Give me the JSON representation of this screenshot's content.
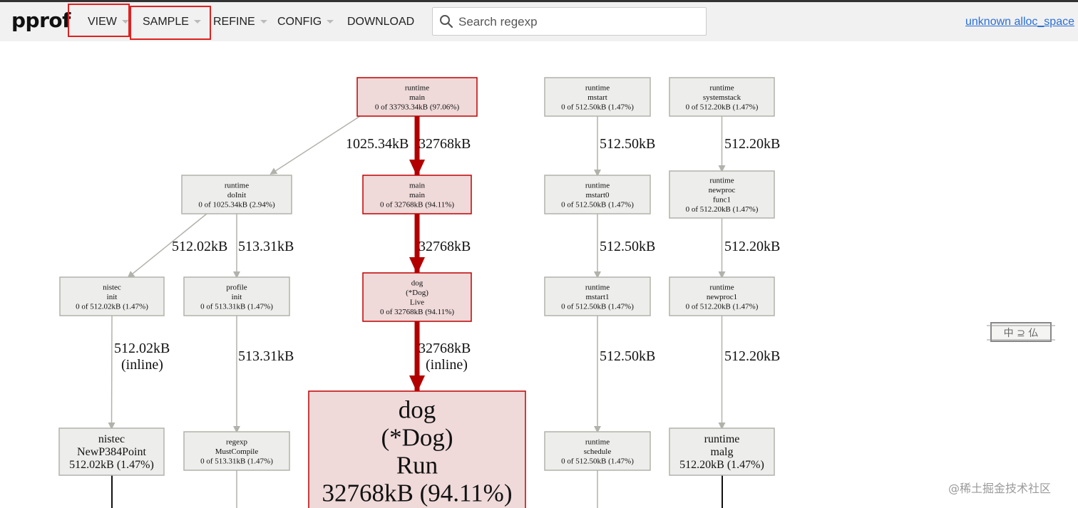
{
  "app": {
    "logo": "pprof"
  },
  "menu": {
    "view": "VIEW",
    "sample": "SAMPLE",
    "refine": "REFINE",
    "config": "CONFIG",
    "download": "DOWNLOAD"
  },
  "search": {
    "placeholder": "Search regexp",
    "value": ""
  },
  "sample_type_link": "unknown alloc_space",
  "nodes": [
    {
      "id": "runtime_main",
      "lines": [
        "runtime",
        "main",
        "0 of 33793.34kB (97.06%)"
      ],
      "hot": true,
      "big": false
    },
    {
      "id": "runtime_doInit",
      "lines": [
        "runtime",
        "doInit",
        "0 of 1025.34kB (2.94%)"
      ],
      "hot": false,
      "big": false
    },
    {
      "id": "main_main",
      "lines": [
        "main",
        "main",
        "0 of 32768kB (94.11%)"
      ],
      "hot": true,
      "big": false
    },
    {
      "id": "nistec_init",
      "lines": [
        "nistec",
        "init",
        "0 of 512.02kB (1.47%)"
      ],
      "hot": false,
      "big": false
    },
    {
      "id": "profile_init",
      "lines": [
        "profile",
        "init",
        "0 of 513.31kB (1.47%)"
      ],
      "hot": false,
      "big": false
    },
    {
      "id": "dog_live",
      "lines": [
        "dog",
        "(*Dog)",
        "Live",
        "0 of 32768kB (94.11%)"
      ],
      "hot": true,
      "big": false
    },
    {
      "id": "nistec_newp384",
      "lines": [
        "nistec",
        "NewP384Point",
        "512.02kB (1.47%)"
      ],
      "hot": false,
      "big": true
    },
    {
      "id": "regexp_mustcompile",
      "lines": [
        "regexp",
        "MustCompile",
        "0 of 513.31kB (1.47%)"
      ],
      "hot": false,
      "big": false
    },
    {
      "id": "dog_run",
      "lines": [
        "dog",
        "(*Dog)",
        "Run",
        "32768kB (94.11%)"
      ],
      "hot": true,
      "big": true
    },
    {
      "id": "runtime_mstart",
      "lines": [
        "runtime",
        "mstart",
        "0 of 512.50kB (1.47%)"
      ],
      "hot": false,
      "big": false
    },
    {
      "id": "runtime_mstart0",
      "lines": [
        "runtime",
        "mstart0",
        "0 of 512.50kB (1.47%)"
      ],
      "hot": false,
      "big": false
    },
    {
      "id": "runtime_mstart1",
      "lines": [
        "runtime",
        "mstart1",
        "0 of 512.50kB (1.47%)"
      ],
      "hot": false,
      "big": false
    },
    {
      "id": "runtime_schedule",
      "lines": [
        "runtime",
        "schedule",
        "0 of 512.50kB (1.47%)"
      ],
      "hot": false,
      "big": false
    },
    {
      "id": "runtime_systemstack",
      "lines": [
        "runtime",
        "systemstack",
        "0 of 512.20kB (1.47%)"
      ],
      "hot": false,
      "big": false
    },
    {
      "id": "runtime_newproc_func1",
      "lines": [
        "runtime",
        "newproc",
        "func1",
        "0 of 512.20kB (1.47%)"
      ],
      "hot": false,
      "big": false
    },
    {
      "id": "runtime_newproc1",
      "lines": [
        "runtime",
        "newproc1",
        "0 of 512.20kB (1.47%)"
      ],
      "hot": false,
      "big": false
    },
    {
      "id": "runtime_malg",
      "lines": [
        "runtime",
        "malg",
        "512.20kB (1.47%)"
      ],
      "hot": false,
      "big": true
    }
  ],
  "edges": [
    {
      "from": "runtime_main",
      "to": "runtime_doInit",
      "label": [
        "1025.34kB"
      ],
      "hot": false
    },
    {
      "from": "runtime_main",
      "to": "main_main",
      "label": [
        "32768kB"
      ],
      "hot": true
    },
    {
      "from": "runtime_doInit",
      "to": "nistec_init",
      "label": [
        "512.02kB"
      ],
      "hot": false
    },
    {
      "from": "runtime_doInit",
      "to": "profile_init",
      "label": [
        "513.31kB"
      ],
      "hot": false
    },
    {
      "from": "main_main",
      "to": "dog_live",
      "label": [
        "32768kB"
      ],
      "hot": true
    },
    {
      "from": "nistec_init",
      "to": "nistec_newp384",
      "label": [
        "512.02kB",
        "(inline)"
      ],
      "hot": false
    },
    {
      "from": "profile_init",
      "to": "regexp_mustcompile",
      "label": [
        "513.31kB"
      ],
      "hot": false
    },
    {
      "from": "dog_live",
      "to": "dog_run",
      "label": [
        "32768kB",
        "(inline)"
      ],
      "hot": true
    },
    {
      "from": "runtime_mstart",
      "to": "runtime_mstart0",
      "label": [
        "512.50kB"
      ],
      "hot": false
    },
    {
      "from": "runtime_mstart0",
      "to": "runtime_mstart1",
      "label": [
        "512.50kB"
      ],
      "hot": false
    },
    {
      "from": "runtime_mstart1",
      "to": "runtime_schedule",
      "label": [
        "512.50kB"
      ],
      "hot": false
    },
    {
      "from": "runtime_systemstack",
      "to": "runtime_newproc_func1",
      "label": [
        "512.20kB"
      ],
      "hot": false
    },
    {
      "from": "runtime_newproc_func1",
      "to": "runtime_newproc1",
      "label": [
        "512.20kB"
      ],
      "hot": false
    },
    {
      "from": "runtime_newproc1",
      "to": "runtime_malg",
      "label": [
        "512.20kB"
      ],
      "hot": false
    }
  ],
  "colors": {
    "hot_fill": "#efd9d9",
    "hot_stroke": "#c00000",
    "cold_fill": "#ededeb",
    "cold_stroke": "#b2b2ac",
    "cold_edge": "#b2b2ac",
    "hot_edge": "#b20000",
    "highlight": "#e02020",
    "link": "#2a6fd6"
  },
  "stamp": {
    "text": "中 ⊇ 仏"
  },
  "watermark": "@稀土掘金技术社区"
}
